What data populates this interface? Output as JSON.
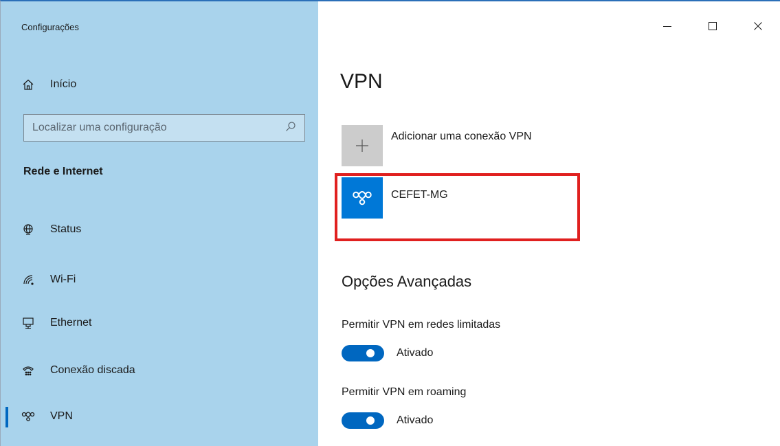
{
  "window": {
    "title": "Configurações"
  },
  "sidebar": {
    "home_label": "Início",
    "search_placeholder": "Localizar uma configuração",
    "section_title": "Rede e Internet",
    "items": [
      {
        "label": "Status",
        "icon": "globe-icon"
      },
      {
        "label": "Wi-Fi",
        "icon": "wifi-icon"
      },
      {
        "label": "Ethernet",
        "icon": "ethernet-icon"
      },
      {
        "label": "Conexão discada",
        "icon": "dialup-icon"
      },
      {
        "label": "VPN",
        "icon": "vpn-icon",
        "active": true
      }
    ]
  },
  "main": {
    "title": "VPN",
    "add_connection_label": "Adicionar uma conexão VPN",
    "vpn_connection_name": "CEFET-MG",
    "advanced_title": "Opções Avançadas",
    "options": [
      {
        "label": "Permitir VPN em redes limitadas",
        "state": "Ativado",
        "on": true
      },
      {
        "label": "Permitir VPN em roaming",
        "state": "Ativado",
        "on": true
      }
    ]
  },
  "colors": {
    "sidebar_bg": "#a9d3ec",
    "accent": "#0078d7",
    "toggle_on": "#0067c0",
    "highlight": "#e0201f"
  }
}
